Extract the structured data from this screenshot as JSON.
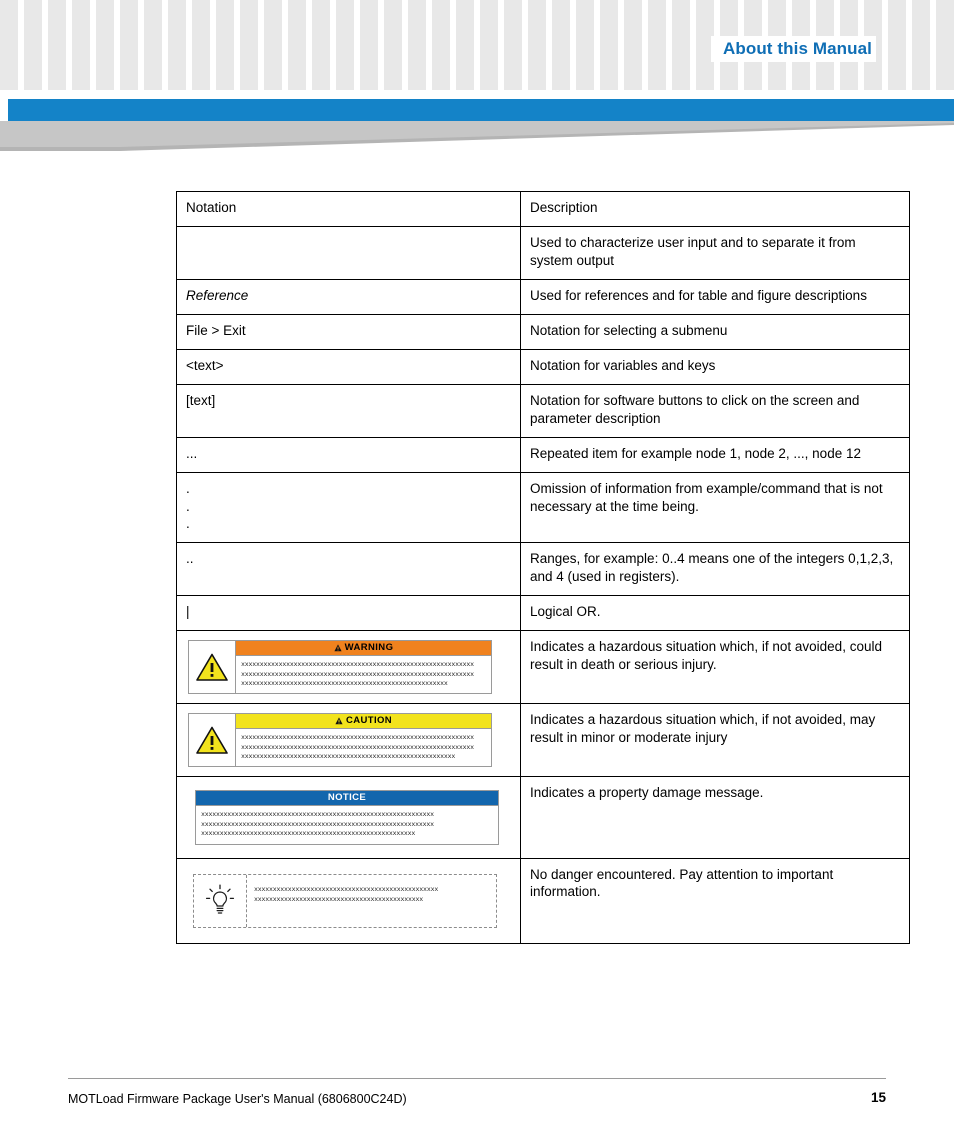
{
  "header": {
    "title": "About this Manual"
  },
  "table": {
    "headers": {
      "notation": "Notation",
      "description": "Description"
    },
    "rows": [
      {
        "notation": "",
        "description": "Used to characterize user input and to separate it from system output",
        "style": "plain"
      },
      {
        "notation": "Reference",
        "description": "Used for references and for table and figure descriptions",
        "style": "italic"
      },
      {
        "notation": "File > Exit",
        "description": "Notation for selecting a submenu",
        "style": "plain"
      },
      {
        "notation": "<text>",
        "description": "Notation for  variables and keys",
        "style": "plain"
      },
      {
        "notation": "[text]",
        "description": "Notation for software buttons to click on the screen and parameter description",
        "style": "plain"
      },
      {
        "notation": "...",
        "description": "Repeated item for example node 1, node 2, ..., node 12",
        "style": "plain"
      },
      {
        "notation": ".\n.\n.",
        "description": "Omission of information from example/command that is not necessary at the time being.",
        "style": "dots"
      },
      {
        "notation": "..",
        "description": "Ranges, for example: 0..4 means one of the integers 0,1,2,3, and 4 (used in registers).",
        "style": "plain"
      },
      {
        "notation": "|",
        "description": "Logical OR.",
        "style": "plain"
      },
      {
        "notation": "",
        "description": "Indicates a hazardous situation which, if not avoided, could result in death or serious injury.",
        "style": "warning-graphic"
      },
      {
        "notation": "",
        "description": "Indicates a hazardous situation which, if not avoided, may result in minor or moderate injury",
        "style": "caution-graphic"
      },
      {
        "notation": "",
        "description": "Indicates a property damage message.",
        "style": "notice-graphic"
      },
      {
        "notation": "",
        "description": "No danger encountered. Pay attention to important information.",
        "style": "tip-graphic"
      }
    ]
  },
  "admonitions": {
    "warning_label": "WARNING",
    "caution_label": "CAUTION",
    "notice_label": "NOTICE",
    "placeholder_lines": {
      "warning": [
        "xxxxxxxxxxxxxxxxxxxxxxxxxxxxxxxxxxxxxxxxxxxxxxxxxxxxxxxxxxxxxx",
        "xxxxxxxxxxxxxxxxxxxxxxxxxxxxxxxxxxxxxxxxxxxxxxxxxxxxxxxxxxxxxx",
        "xxxxxxxxxxxxxxxxxxxxxxxxxxxxxxxxxxxxxxxxxxxxxxxxxxxxxxx"
      ],
      "caution": [
        "xxxxxxxxxxxxxxxxxxxxxxxxxxxxxxxxxxxxxxxxxxxxxxxxxxxxxxxxxxxxxx",
        "xxxxxxxxxxxxxxxxxxxxxxxxxxxxxxxxxxxxxxxxxxxxxxxxxxxxxxxxxxxxxx",
        "xxxxxxxxxxxxxxxxxxxxxxxxxxxxxxxxxxxxxxxxxxxxxxxxxxxxxxxxx"
      ],
      "notice": [
        "xxxxxxxxxxxxxxxxxxxxxxxxxxxxxxxxxxxxxxxxxxxxxxxxxxxxxxxxxxxxxx",
        "xxxxxxxxxxxxxxxxxxxxxxxxxxxxxxxxxxxxxxxxxxxxxxxxxxxxxxxxxxxxxx",
        "xxxxxxxxxxxxxxxxxxxxxxxxxxxxxxxxxxxxxxxxxxxxxxxxxxxxxxxxx"
      ],
      "tip": [
        "xxxxxxxxxxxxxxxxxxxxxxxxxxxxxxxxxxxxxxxxxxxxxxxxx",
        "xxxxxxxxxxxxxxxxxxxxxxxxxxxxxxxxxxxxxxxxxxxxx"
      ]
    }
  },
  "footer": {
    "manual_title": "MOTLoad Firmware Package User's Manual (6806800C24D)",
    "page_number": "15"
  },
  "colors": {
    "accent_blue": "#1483c8",
    "title_blue": "#0f6eb5",
    "warning_orange": "#f0821e",
    "caution_yellow": "#f2e31d",
    "notice_blue": "#1366ad",
    "checker_grey": "#e8e8e8"
  }
}
